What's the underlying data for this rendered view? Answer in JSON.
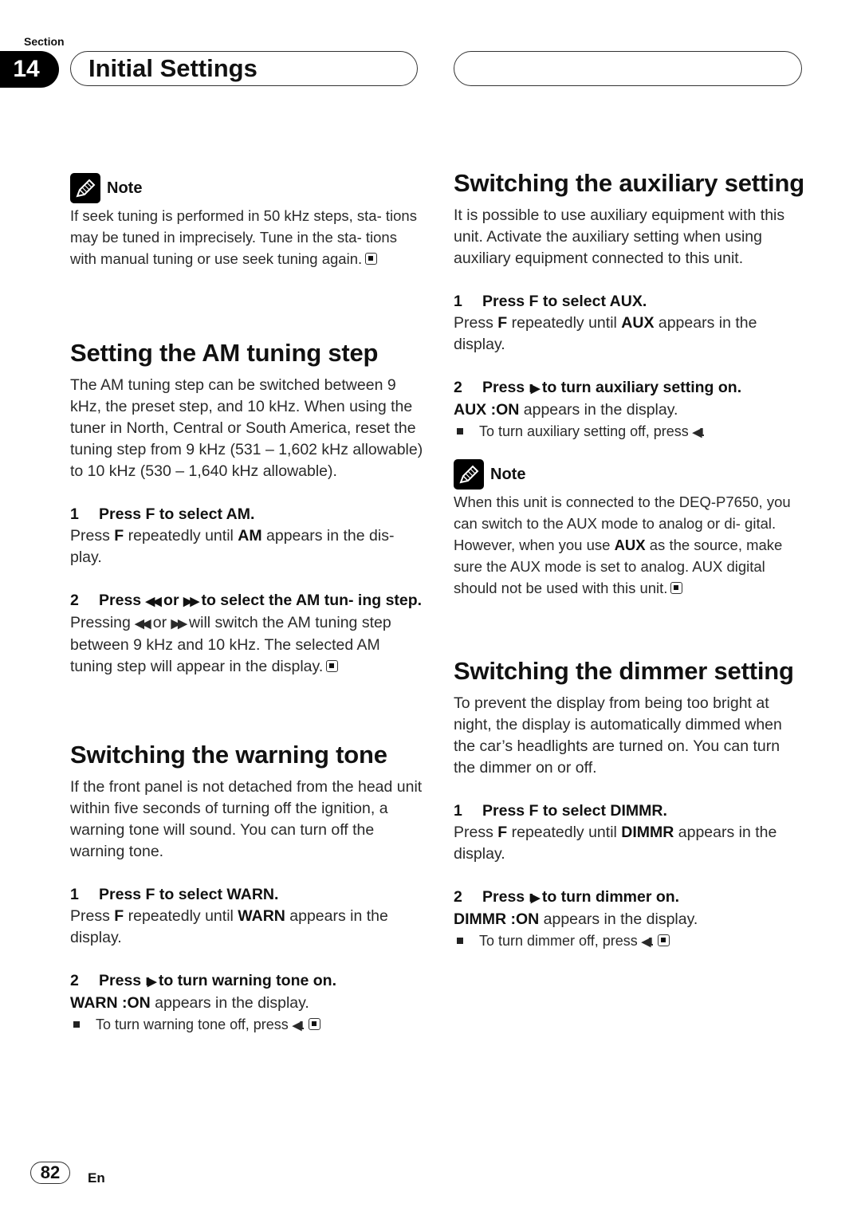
{
  "header": {
    "section_label": "Section",
    "section_number": "14",
    "title": "Initial Settings"
  },
  "left": {
    "note1": {
      "label": "Note",
      "icon": "pencil-note-icon",
      "text": "If seek tuning is performed in 50 kHz steps, sta- tions may be tuned in imprecisely. Tune in the sta- tions with manual tuning or use seek tuning again."
    },
    "am": {
      "heading": "Setting the AM tuning step",
      "intro": "The AM tuning step can be switched between 9 kHz, the preset step, and 10 kHz. When using the tuner in North, Central or South America, reset the tuning step from 9 kHz (531 – 1,602 kHz allowable) to 10 kHz (530 – 1,640 kHz allowable).",
      "step1": {
        "num": "1",
        "title": "Press F to select AM.",
        "pre": "Press ",
        "key": "F",
        "mid": " repeatedly until ",
        "value": "AM",
        "post": " appears in the dis- play."
      },
      "step2": {
        "num": "2",
        "title_pre": "Press ",
        "glyph_rew": "◀◀",
        "title_or": " or ",
        "glyph_ff": "▶▶",
        "title_post": " to select the AM tun- ing step.",
        "body_pre": "Pressing ",
        "body_or": " or ",
        "body_post": " will switch the AM tuning step between 9 kHz and 10 kHz. The selected AM tuning step will appear in the display."
      }
    },
    "warn": {
      "heading": "Switching the warning tone",
      "intro": "If the front panel is not detached from the head unit within five seconds of turning off the ignition, a warning tone will sound. You can turn off the warning tone.",
      "step1": {
        "num": "1",
        "title": "Press F to select WARN.",
        "pre": "Press ",
        "key": "F",
        "mid": " repeatedly until ",
        "value": "WARN",
        "post": " appears in the display."
      },
      "step2": {
        "num": "2",
        "title_pre": "Press ",
        "glyph_on": "II▶",
        "title_post": " to turn warning tone on.",
        "status": "WARN :ON",
        "status_post": " appears in the display.",
        "bullet_pre": "To turn warning tone off, press ",
        "glyph_off": "◀II",
        "bullet_post": "."
      }
    }
  },
  "right": {
    "aux": {
      "heading": "Switching the auxiliary setting",
      "intro": "It is possible to use auxiliary equipment with this unit. Activate the auxiliary setting when using auxiliary equipment connected to this unit.",
      "step1": {
        "num": "1",
        "title": "Press F to select AUX.",
        "pre": "Press ",
        "key": "F",
        "mid": " repeatedly until ",
        "value": "AUX",
        "post": " appears in the display."
      },
      "step2": {
        "num": "2",
        "title_pre": "Press ",
        "glyph_on": "II▶",
        "title_post": " to turn auxiliary setting on.",
        "status": "AUX :ON",
        "status_post": " appears in the display.",
        "bullet_pre": "To turn auxiliary setting off, press ",
        "glyph_off": "◀II",
        "bullet_post": "."
      }
    },
    "note2": {
      "label": "Note",
      "icon": "pencil-note-icon",
      "text_pre": "When this unit is connected to the DEQ-P7650, you can switch to the AUX mode to analog or di- gital. However, when you use ",
      "text_bold": "AUX",
      "text_post": " as the source, make sure the AUX mode is set to analog. AUX digital should not be used with this unit."
    },
    "dimmer": {
      "heading": "Switching the dimmer setting",
      "intro": "To prevent the display from being too bright at night, the display is automatically dimmed when the car’s headlights are turned on. You can turn the dimmer on or off.",
      "step1": {
        "num": "1",
        "title": "Press F to select DIMMR.",
        "pre": "Press ",
        "key": "F",
        "mid": " repeatedly until ",
        "value": "DIMMR",
        "post": " appears in the display."
      },
      "step2": {
        "num": "2",
        "title_pre": "Press ",
        "glyph_on": "II▶",
        "title_post": " to turn dimmer on.",
        "status": "DIMMR :ON",
        "status_post": " appears in the display.",
        "bullet_pre": "To turn dimmer off, press ",
        "glyph_off": "◀II",
        "bullet_post": "."
      }
    }
  },
  "footer": {
    "page_number": "82",
    "language": "En"
  }
}
